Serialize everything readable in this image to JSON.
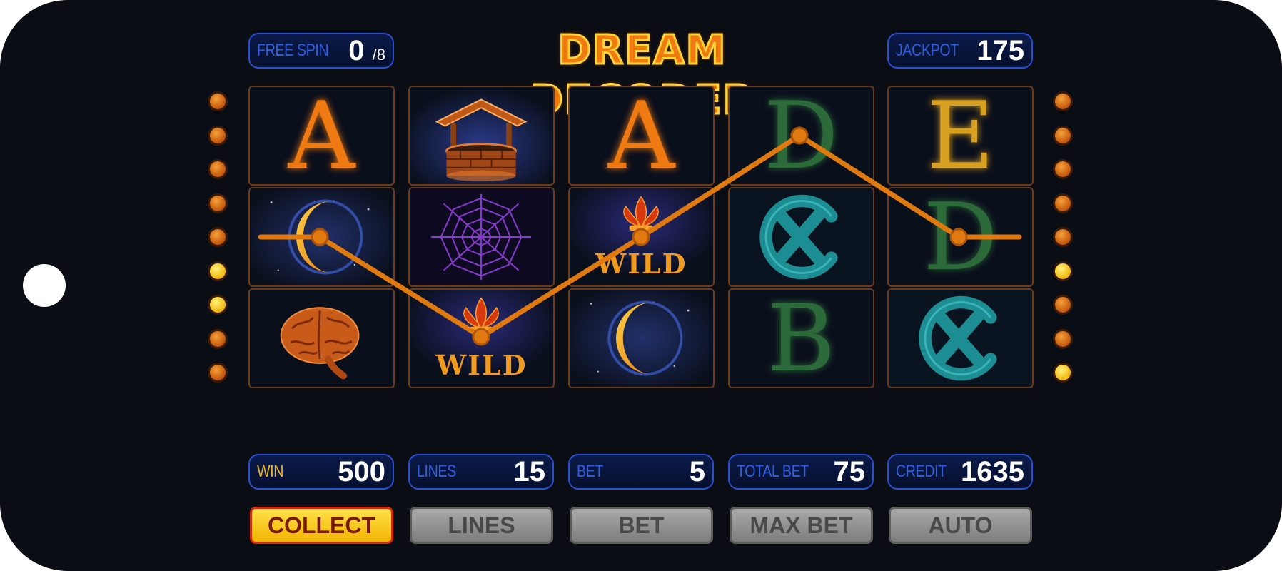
{
  "game": {
    "title": "DREAM DECODER"
  },
  "header": {
    "free_spin": {
      "label": "FREE SPIN",
      "value": "0",
      "max": "/8"
    },
    "jackpot": {
      "label": "JACKPOT",
      "value": "175"
    }
  },
  "reels": [
    [
      {
        "symbol": "A",
        "color": "#f07a12"
      },
      {
        "symbol": "well-icon"
      },
      {
        "symbol": "A",
        "color": "#f07a12"
      },
      {
        "symbol": "D",
        "color": "#2d6a3a"
      },
      {
        "symbol": "E",
        "color": "#d8a020"
      }
    ],
    [
      {
        "symbol": "moon-icon"
      },
      {
        "symbol": "spiderweb-icon"
      },
      {
        "symbol": "fleur-de-lis-icon",
        "wild": "WILD"
      },
      {
        "symbol": "crossed-circle-icon"
      },
      {
        "symbol": "D",
        "color": "#2d6a3a"
      }
    ],
    [
      {
        "symbol": "brain-icon"
      },
      {
        "symbol": "fleur-de-lis-icon",
        "wild": "WILD"
      },
      {
        "symbol": "moon-icon"
      },
      {
        "symbol": "B",
        "color": "#2d6a3a"
      },
      {
        "symbol": "crossed-circle-icon"
      }
    ]
  ],
  "line_indicators": {
    "left": [
      "off",
      "off",
      "off",
      "off",
      "off",
      "lit",
      "lit",
      "off",
      "off"
    ],
    "right": [
      "off",
      "off",
      "off",
      "off",
      "off",
      "lit",
      "off",
      "off",
      "lit"
    ]
  },
  "payline": {
    "color": "#e07a10"
  },
  "stats": {
    "win": {
      "label": "WIN",
      "value": "500"
    },
    "lines": {
      "label": "LINES",
      "value": "15"
    },
    "bet": {
      "label": "BET",
      "value": "5"
    },
    "total_bet": {
      "label": "TOTAL BET",
      "value": "75"
    },
    "credit": {
      "label": "CREDIT",
      "value": "1635"
    }
  },
  "buttons": {
    "collect": "COLLECT",
    "lines": "LINES",
    "bet": "BET",
    "max_bet": "MAX BET",
    "auto": "AUTO"
  }
}
